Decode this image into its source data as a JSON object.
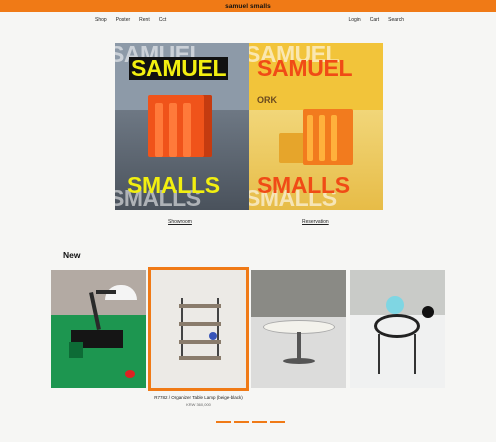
{
  "header": {
    "brand": "samuel smalls"
  },
  "nav": {
    "left": [
      "Shop",
      "Poster",
      "Rent",
      "Cct"
    ],
    "right": [
      "Login",
      "Cart",
      "Search"
    ]
  },
  "heroes": [
    {
      "top_text": "SAMUEL",
      "bottom_text": "SMALLS",
      "link": "Showroom"
    },
    {
      "top_text": "SAMUEL",
      "bottom_text": "SMALLS",
      "link": "Reservation",
      "side_text": "ORK"
    }
  ],
  "section": {
    "title": "New"
  },
  "product": {
    "caption": "R7782 / Organizer Table Lamp (beige-black)",
    "price": "KRW 360,000"
  },
  "pagination": {
    "count": 4,
    "active": 0
  },
  "colors": {
    "accent": "#f07a16",
    "hero_yellow": "#f2ef10",
    "hero_red": "#f04b16"
  }
}
